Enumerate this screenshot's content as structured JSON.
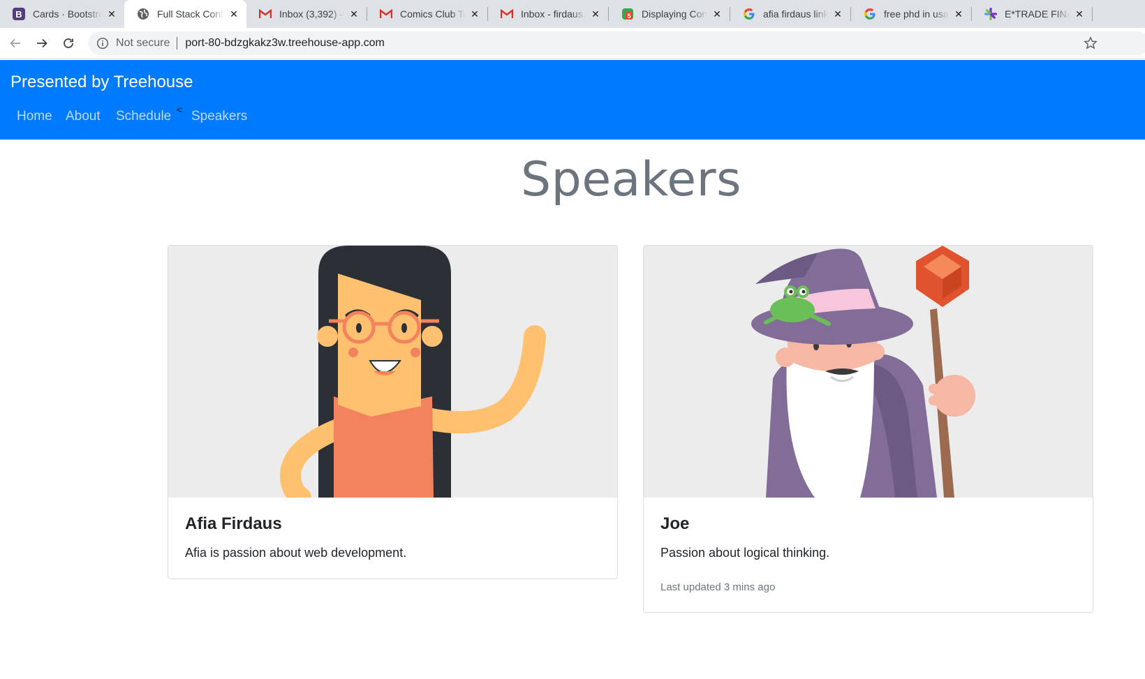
{
  "browser": {
    "tabs": [
      {
        "title": "Cards · Bootstrap",
        "icon": "bootstrap-icon"
      },
      {
        "title": "Full Stack Conf",
        "icon": "globe-icon"
      },
      {
        "title": "Inbox (3,392) - ",
        "icon": "gmail-icon"
      },
      {
        "title": "Comics Club Tod",
        "icon": "gmail-icon"
      },
      {
        "title": "Inbox - firdaus.",
        "icon": "gmail-icon"
      },
      {
        "title": "Displaying Con",
        "icon": "html5-icon"
      },
      {
        "title": "afia firdaus link",
        "icon": "google-icon"
      },
      {
        "title": "free phd in usa",
        "icon": "google-icon"
      },
      {
        "title": "E*TRADE FINAN",
        "icon": "etrade-icon"
      }
    ],
    "active_tab": 1,
    "security_label": "Not secure",
    "url": "port-80-bdzgkakz3w.treehouse-app.com"
  },
  "navbar": {
    "brand": "Presented by Treehouse",
    "links": [
      "Home",
      "About",
      "Schedule",
      "Speakers"
    ],
    "caret": "<",
    "color": "#007bff"
  },
  "page": {
    "heading": "Speakers"
  },
  "speakers": [
    {
      "name": "Afia Firdaus",
      "bio": "Afia is passion about web development.",
      "updated": ""
    },
    {
      "name": "Joe",
      "bio": "Passion about logical thinking.",
      "updated": "Last updated 3 mins ago"
    }
  ]
}
